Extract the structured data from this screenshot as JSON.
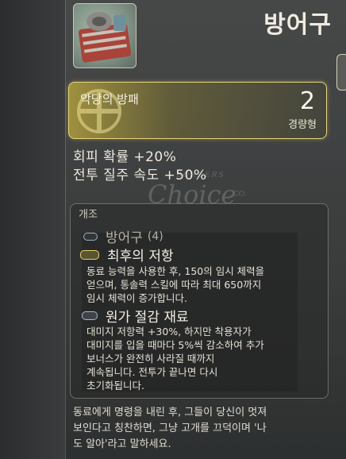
{
  "header": {
    "title": "방어구",
    "item_icon": "armor-bundle-icon"
  },
  "rank": {
    "name": "악당의 방패",
    "number": "2",
    "type": "경량형",
    "emblem_icon": "armor-emblem-icon",
    "accent_color": "#e6d57a"
  },
  "stats": [
    "회피 확률 +20%",
    "전투 질주 속도 +50%"
  ],
  "watermark": {
    "small": "BORDERS",
    "big": "Choice",
    "suffix": "CO."
  },
  "mods": {
    "header": "개조",
    "slot": {
      "label": "방어구",
      "count": "(4)",
      "icon": "slot-pill-icon"
    },
    "items": [
      {
        "name": "최후의 저항",
        "icon": "gold-mod-icon",
        "description": "동료 능력을 사용한 후, 150의 임시 체력을\n얻으며, 통솔력 스킬에 따라 최대 650까지\n임시 체력이 증가합니다."
      },
      {
        "name": "원가 절감 재료",
        "icon": "steel-mod-icon",
        "description": "대미지 저항력 +30%, 하지만 착용자가\n대미지를 입을 때마다 5%씩 감소하여 추가\n보너스가 완전히 사라질 때까지\n계속됩니다. 전투가 끝나면 다시\n초기화됩니다."
      }
    ]
  },
  "flavor": "동료에게 명령을 내린 후, 그들이 당신이 멋져\n보인다고 칭찬하면, 그냥 고개를 끄덕이며 '나\n도 알아'라고 말하세요."
}
